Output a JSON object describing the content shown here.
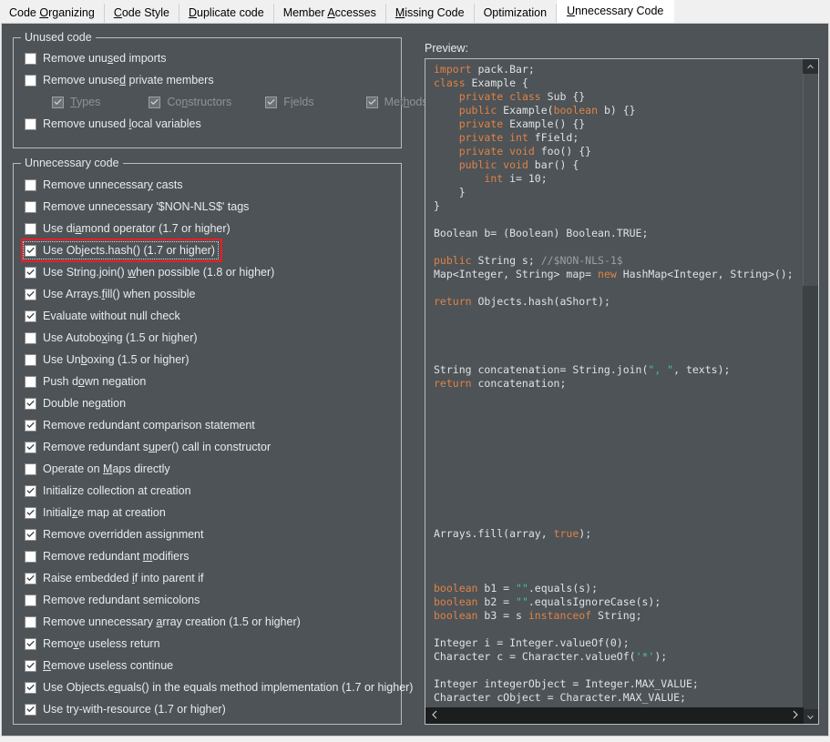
{
  "tabs": [
    {
      "label_pre": "Code ",
      "mnemonic": "O",
      "label_post": "rganizing",
      "active": false,
      "name": "tab-code-organizing"
    },
    {
      "label_pre": "",
      "mnemonic": "C",
      "label_post": "ode Style",
      "active": false,
      "name": "tab-code-style"
    },
    {
      "label_pre": "",
      "mnemonic": "D",
      "label_post": "uplicate code",
      "active": false,
      "name": "tab-duplicate-code"
    },
    {
      "label_pre": "Member ",
      "mnemonic": "A",
      "label_post": "ccesses",
      "active": false,
      "name": "tab-member-accesses"
    },
    {
      "label_pre": "",
      "mnemonic": "M",
      "label_post": "issing Code",
      "active": false,
      "name": "tab-missing-code"
    },
    {
      "label_pre": "Optimization",
      "mnemonic": "",
      "label_post": "",
      "active": false,
      "name": "tab-optimization"
    },
    {
      "label_pre": "",
      "mnemonic": "U",
      "label_post": "nnecessary Code",
      "active": true,
      "name": "tab-unnecessary-code"
    }
  ],
  "groups": [
    {
      "name": "group-unused-code",
      "title": "Unused code",
      "items": [
        {
          "pre": "Remove unu",
          "mn": "s",
          "post": "ed imports",
          "checked": false,
          "disabled": false,
          "indent": false,
          "focused": false,
          "name": "checkbox-remove-unused-imports"
        },
        {
          "pre": "Remove unuse",
          "mn": "d",
          "post": " private members",
          "checked": false,
          "disabled": false,
          "indent": false,
          "focused": false,
          "name": "checkbox-remove-unused-private-members"
        },
        {
          "pre": "",
          "mn": "T",
          "post": "ypes",
          "checked": true,
          "disabled": true,
          "indent": true,
          "focused": false,
          "name": "checkbox-types",
          "inline": 0
        },
        {
          "pre": "Co",
          "mn": "n",
          "post": "structors",
          "checked": true,
          "disabled": true,
          "indent": true,
          "focused": false,
          "name": "checkbox-constructors",
          "inline": 1
        },
        {
          "pre": "F",
          "mn": "i",
          "post": "elds",
          "checked": true,
          "disabled": true,
          "indent": true,
          "focused": false,
          "name": "checkbox-fields",
          "inline": 2
        },
        {
          "pre": "Met",
          "mn": "h",
          "post": "ods",
          "checked": true,
          "disabled": true,
          "indent": true,
          "focused": false,
          "name": "checkbox-methods",
          "inline": 3
        },
        {
          "pre": "Remove unused ",
          "mn": "l",
          "post": "ocal variables",
          "checked": false,
          "disabled": false,
          "indent": false,
          "focused": false,
          "name": "checkbox-remove-unused-local-variables"
        }
      ]
    },
    {
      "name": "group-unnecessary-code",
      "title": "Unnecessary code",
      "items": [
        {
          "pre": "Remove unnecessar",
          "mn": "y",
          "post": " casts",
          "checked": false,
          "disabled": false,
          "focused": false,
          "name": "checkbox-remove-unnecessary-casts"
        },
        {
          "pre": "Remove unnecessary '$NON-NLS$' ta",
          "mn": "g",
          "post": "s",
          "checked": false,
          "disabled": false,
          "focused": false,
          "name": "checkbox-remove-non-nls-tags"
        },
        {
          "pre": "Use di",
          "mn": "a",
          "post": "mond operator (1.7 or higher)",
          "checked": false,
          "disabled": false,
          "focused": false,
          "name": "checkbox-use-diamond-operator"
        },
        {
          "pre": "Use Objects.hash() (1.7 or higher)",
          "mn": "",
          "post": "",
          "checked": true,
          "disabled": false,
          "focused": true,
          "name": "checkbox-use-objects-hash"
        },
        {
          "pre": "Use String.join() ",
          "mn": "w",
          "post": "hen possible (1.8 or higher)",
          "checked": true,
          "disabled": false,
          "focused": false,
          "name": "checkbox-use-string-join"
        },
        {
          "pre": "Use Arrays.",
          "mn": "f",
          "post": "ill() when possible",
          "checked": true,
          "disabled": false,
          "focused": false,
          "name": "checkbox-use-arrays-fill"
        },
        {
          "pre": "Evaluate without null check",
          "mn": "",
          "post": "",
          "checked": true,
          "disabled": false,
          "focused": false,
          "name": "checkbox-evaluate-without-null-check"
        },
        {
          "pre": "Use Autobo",
          "mn": "x",
          "post": "ing (1.5 or higher)",
          "checked": false,
          "disabled": false,
          "focused": false,
          "name": "checkbox-use-autoboxing"
        },
        {
          "pre": "Use Un",
          "mn": "b",
          "post": "oxing (1.5 or higher)",
          "checked": false,
          "disabled": false,
          "focused": false,
          "name": "checkbox-use-unboxing"
        },
        {
          "pre": "Push d",
          "mn": "o",
          "post": "wn negation",
          "checked": false,
          "disabled": false,
          "focused": false,
          "name": "checkbox-push-down-negation"
        },
        {
          "pre": "Double negation",
          "mn": "",
          "post": "",
          "checked": true,
          "disabled": false,
          "focused": false,
          "name": "checkbox-double-negation"
        },
        {
          "pre": "Remove redundant comparison statement",
          "mn": "",
          "post": "",
          "checked": true,
          "disabled": false,
          "focused": false,
          "name": "checkbox-remove-redundant-comparison-statement"
        },
        {
          "pre": "Remove redundant s",
          "mn": "u",
          "post": "per() call in constructor",
          "checked": true,
          "disabled": false,
          "focused": false,
          "name": "checkbox-remove-redundant-super-call"
        },
        {
          "pre": "Operate on ",
          "mn": "M",
          "post": "aps directly",
          "checked": false,
          "disabled": false,
          "focused": false,
          "name": "checkbox-operate-on-maps-directly"
        },
        {
          "pre": "Initialize collection at creation",
          "mn": "",
          "post": "",
          "checked": true,
          "disabled": false,
          "focused": false,
          "name": "checkbox-initialize-collection-at-creation"
        },
        {
          "pre": "Initiali",
          "mn": "z",
          "post": "e map at creation",
          "checked": true,
          "disabled": false,
          "focused": false,
          "name": "checkbox-initialize-map-at-creation"
        },
        {
          "pre": "Remove overridden assignment",
          "mn": "",
          "post": "",
          "checked": true,
          "disabled": false,
          "focused": false,
          "name": "checkbox-remove-overridden-assignment"
        },
        {
          "pre": "Remove redundant ",
          "mn": "m",
          "post": "odifiers",
          "checked": false,
          "disabled": false,
          "focused": false,
          "name": "checkbox-remove-redundant-modifiers"
        },
        {
          "pre": "Raise embedded ",
          "mn": "i",
          "post": "f into parent if",
          "checked": true,
          "disabled": false,
          "focused": false,
          "name": "checkbox-raise-embedded-if"
        },
        {
          "pre": "Remove redundant semicolons",
          "mn": "",
          "post": "",
          "checked": false,
          "disabled": false,
          "focused": false,
          "name": "checkbox-remove-redundant-semicolons"
        },
        {
          "pre": "Remove unnecessary ",
          "mn": "a",
          "post": "rray creation (1.5 or higher)",
          "checked": false,
          "disabled": false,
          "focused": false,
          "name": "checkbox-remove-unnecessary-array-creation"
        },
        {
          "pre": "Remo",
          "mn": "v",
          "post": "e useless return",
          "checked": true,
          "disabled": false,
          "focused": false,
          "name": "checkbox-remove-useless-return"
        },
        {
          "pre": "",
          "mn": "R",
          "post": "emove useless continue",
          "checked": true,
          "disabled": false,
          "focused": false,
          "name": "checkbox-remove-useless-continue"
        },
        {
          "pre": "Use Objects.e",
          "mn": "q",
          "post": "uals() in the equals method implementation (1.7 or higher)",
          "checked": true,
          "disabled": false,
          "focused": false,
          "name": "checkbox-use-objects-equals"
        },
        {
          "pre": "Use try-with-resource (1.7 or higher)",
          "mn": "",
          "post": "",
          "checked": true,
          "disabled": false,
          "focused": false,
          "name": "checkbox-use-try-with-resource"
        }
      ]
    }
  ],
  "preview": {
    "label": "Preview:",
    "code_lines": [
      [
        {
          "t": "import",
          "c": "kw"
        },
        {
          "t": " pack.Bar;",
          "c": ""
        }
      ],
      [
        {
          "t": "class",
          "c": "kw"
        },
        {
          "t": " Example {",
          "c": ""
        }
      ],
      [
        {
          "t": "    ",
          "c": ""
        },
        {
          "t": "private class",
          "c": "kw"
        },
        {
          "t": " Sub {}",
          "c": ""
        }
      ],
      [
        {
          "t": "    ",
          "c": ""
        },
        {
          "t": "public",
          "c": "kw"
        },
        {
          "t": " Example(",
          "c": ""
        },
        {
          "t": "boolean",
          "c": "kw"
        },
        {
          "t": " b) {}",
          "c": ""
        }
      ],
      [
        {
          "t": "    ",
          "c": ""
        },
        {
          "t": "private",
          "c": "kw"
        },
        {
          "t": " Example() {}",
          "c": ""
        }
      ],
      [
        {
          "t": "    ",
          "c": ""
        },
        {
          "t": "private int",
          "c": "kw"
        },
        {
          "t": " fField;",
          "c": ""
        }
      ],
      [
        {
          "t": "    ",
          "c": ""
        },
        {
          "t": "private void",
          "c": "kw"
        },
        {
          "t": " foo() {}",
          "c": ""
        }
      ],
      [
        {
          "t": "    ",
          "c": ""
        },
        {
          "t": "public void",
          "c": "kw"
        },
        {
          "t": " bar() {",
          "c": ""
        }
      ],
      [
        {
          "t": "        ",
          "c": ""
        },
        {
          "t": "int",
          "c": "kw"
        },
        {
          "t": " i= 10;",
          "c": ""
        }
      ],
      [
        {
          "t": "    }",
          "c": ""
        }
      ],
      [
        {
          "t": "}",
          "c": ""
        }
      ],
      [
        {
          "t": "",
          "c": ""
        }
      ],
      [
        {
          "t": "Boolean b= (Boolean) Boolean.TRUE;",
          "c": ""
        }
      ],
      [
        {
          "t": "",
          "c": ""
        }
      ],
      [
        {
          "t": "public",
          "c": "kw"
        },
        {
          "t": " String s; ",
          "c": ""
        },
        {
          "t": "//$NON-NLS-1$",
          "c": "cmt"
        }
      ],
      [
        {
          "t": "Map<Integer, String> map= ",
          "c": ""
        },
        {
          "t": "new",
          "c": "kw"
        },
        {
          "t": " HashMap<Integer, String>();",
          "c": ""
        }
      ],
      [
        {
          "t": "",
          "c": ""
        }
      ],
      [
        {
          "t": "return",
          "c": "kw"
        },
        {
          "t": " Objects.hash(aShort);",
          "c": ""
        }
      ],
      [
        {
          "t": "",
          "c": ""
        }
      ],
      [
        {
          "t": "",
          "c": ""
        }
      ],
      [
        {
          "t": "",
          "c": ""
        }
      ],
      [
        {
          "t": "",
          "c": ""
        }
      ],
      [
        {
          "t": "String concatenation= String.join(",
          "c": ""
        },
        {
          "t": "\", \"",
          "c": "str"
        },
        {
          "t": ", texts);",
          "c": ""
        }
      ],
      [
        {
          "t": "return",
          "c": "kw"
        },
        {
          "t": " concatenation;",
          "c": ""
        }
      ],
      [
        {
          "t": "",
          "c": ""
        }
      ],
      [
        {
          "t": "",
          "c": ""
        }
      ],
      [
        {
          "t": "",
          "c": ""
        }
      ],
      [
        {
          "t": "",
          "c": ""
        }
      ],
      [
        {
          "t": "",
          "c": ""
        }
      ],
      [
        {
          "t": "",
          "c": ""
        }
      ],
      [
        {
          "t": "",
          "c": ""
        }
      ],
      [
        {
          "t": "",
          "c": ""
        }
      ],
      [
        {
          "t": "",
          "c": ""
        }
      ],
      [
        {
          "t": "",
          "c": ""
        }
      ],
      [
        {
          "t": "Arrays.fill(array, ",
          "c": ""
        },
        {
          "t": "true",
          "c": "kw"
        },
        {
          "t": ");",
          "c": ""
        }
      ],
      [
        {
          "t": "",
          "c": ""
        }
      ],
      [
        {
          "t": "",
          "c": ""
        }
      ],
      [
        {
          "t": "",
          "c": ""
        }
      ],
      [
        {
          "t": "boolean",
          "c": "kw"
        },
        {
          "t": " b1 = ",
          "c": ""
        },
        {
          "t": "\"\"",
          "c": "str"
        },
        {
          "t": ".equals(s);",
          "c": ""
        }
      ],
      [
        {
          "t": "boolean",
          "c": "kw"
        },
        {
          "t": " b2 = ",
          "c": ""
        },
        {
          "t": "\"\"",
          "c": "str"
        },
        {
          "t": ".equalsIgnoreCase(s);",
          "c": ""
        }
      ],
      [
        {
          "t": "boolean",
          "c": "kw"
        },
        {
          "t": " b3 = s ",
          "c": ""
        },
        {
          "t": "instanceof",
          "c": "kw"
        },
        {
          "t": " String;",
          "c": ""
        }
      ],
      [
        {
          "t": "",
          "c": ""
        }
      ],
      [
        {
          "t": "Integer i = Integer.valueOf(0);",
          "c": ""
        }
      ],
      [
        {
          "t": "Character c = Character.valueOf(",
          "c": ""
        },
        {
          "t": "'*'",
          "c": "str"
        },
        {
          "t": ");",
          "c": ""
        }
      ],
      [
        {
          "t": "",
          "c": ""
        }
      ],
      [
        {
          "t": "Integer integerObject = Integer.MAX_VALUE;",
          "c": ""
        }
      ],
      [
        {
          "t": "Character cObject = Character.MAX_VALUE;",
          "c": ""
        }
      ]
    ],
    "scroll_up_icon": "chevron-up-icon",
    "scroll_down_icon": "chevron-down-icon",
    "scroll_left_icon": "chevron-left-icon",
    "scroll_right_icon": "chevron-right-icon"
  },
  "colors": {
    "panel_bg": "#4d5357",
    "accent_red": "#ee1c25",
    "keyword": "#e08245",
    "string": "#4fbf9a",
    "comment": "#9aa0a3"
  }
}
